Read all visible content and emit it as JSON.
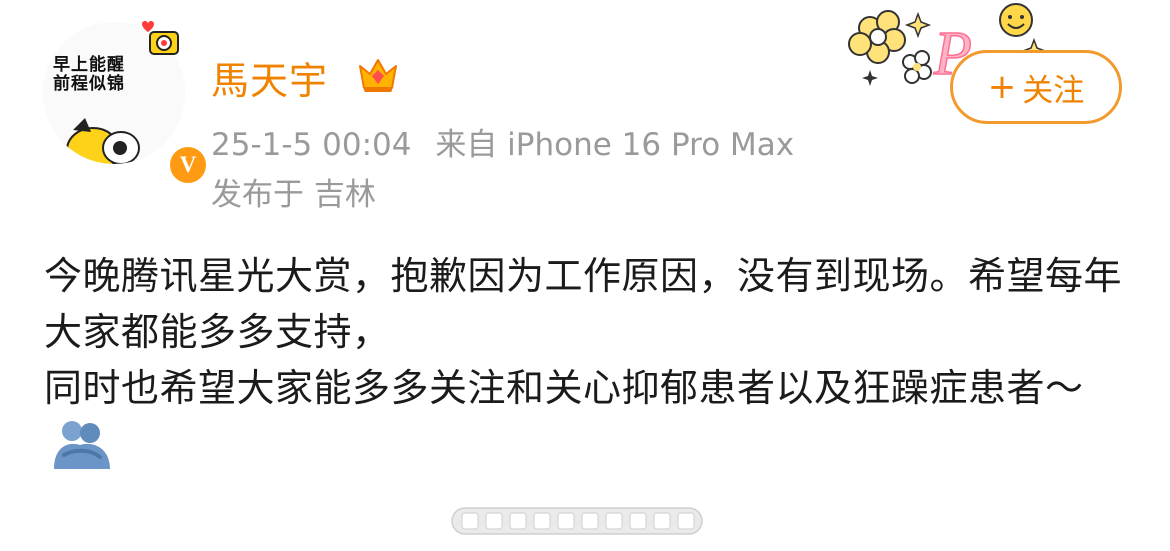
{
  "post": {
    "author": {
      "name": "馬天宇",
      "avatar_text_line1": "早上能醒",
      "avatar_text_line2": "前程似锦",
      "verified_badge": "V",
      "crown_icon": "vip-crown-icon"
    },
    "timestamp": "25-1-5 00:04",
    "source": "来自 iPhone 16 Pro Max",
    "location": "发布于 吉林",
    "follow_button": {
      "plus": "+",
      "label": "关注"
    },
    "content_lines": [
      "今晚腾讯星光大赏，抱歉因为工作原因，没有到现场。希望每年大家都能多多支持，",
      "同时也希望大家能多多关注和关心抑郁患者以及狂躁症患者～"
    ],
    "emoji": "hug-emoji",
    "colors": {
      "name": "#f08200",
      "meta": "#9a9a9a",
      "follow_border": "#f39a2e",
      "text": "#1b1b1b",
      "badge": "#ff9b12"
    }
  }
}
